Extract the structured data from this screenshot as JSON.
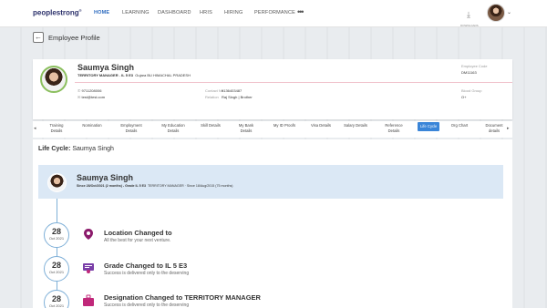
{
  "nav": {
    "logo": "peoplestrong",
    "logo_mark": "®",
    "items": [
      "HOME",
      "LEARNING",
      "DASHBOARD",
      "HRIS",
      "HIRING",
      "PERFORMANCE"
    ],
    "active": "HOME",
    "more": "•••",
    "download_label": "DOWNLOADS"
  },
  "page": {
    "title": "Employee Profile",
    "back": "←"
  },
  "profile": {
    "name": "Saumya Singh",
    "designation": "TERRITORY MANAGER",
    "grade": "IL 5 E3",
    "location": "Gujara BU  HIMACHAL PRADESH",
    "employee_code_label": "Employee Code",
    "employee_code": "DM11163",
    "phone": "9711208006",
    "email": "test@test.com",
    "contact_label": "Contact No.",
    "contact": "9136403487",
    "relation_label": "Relation",
    "relation": "Raj Singh | Brother",
    "blood_label": "Blood Group",
    "blood": "O+"
  },
  "tabs": [
    "Training Details",
    "Nomination",
    "Employment Details",
    "My Education Details",
    "Skill Details",
    "My Bank Details",
    "My ID Proofs",
    "Visa Details",
    "Salary Details",
    "Reference Details",
    "Life Cycle",
    "Org Chart",
    "Document details"
  ],
  "active_tab": "Life Cycle",
  "lifecycle": {
    "heading_prefix": "Life Cycle:",
    "heading_name": "Saumya Singh",
    "banner_name": "Saumya Singh",
    "banner_since": "Since 28/Oct/2021 (2 months) - Grade IL 5 E3",
    "banner_role": "TERRITORY MANAGER",
    "banner_since2": "Since 18/Aug/2015 (75 months)",
    "events": [
      {
        "day": "28",
        "month": "Oct 2021",
        "title": "Location Changed to",
        "subtitle": "All the best for your next venture.",
        "icon": "location-pin-icon",
        "color": "#8b1a6b"
      },
      {
        "day": "28",
        "month": "Oct 2021",
        "title": "Grade Changed to IL 5 E3",
        "subtitle": "Success is delivered only to the deserving",
        "icon": "certificate-icon",
        "color": "#7a3fa8"
      },
      {
        "day": "28",
        "month": "Oct 2021",
        "title": "Designation Changed to TERRITORY MANAGER",
        "subtitle": "Success is delivered only to the deserving",
        "icon": "briefcase-icon",
        "color": "#c0287a"
      }
    ]
  }
}
